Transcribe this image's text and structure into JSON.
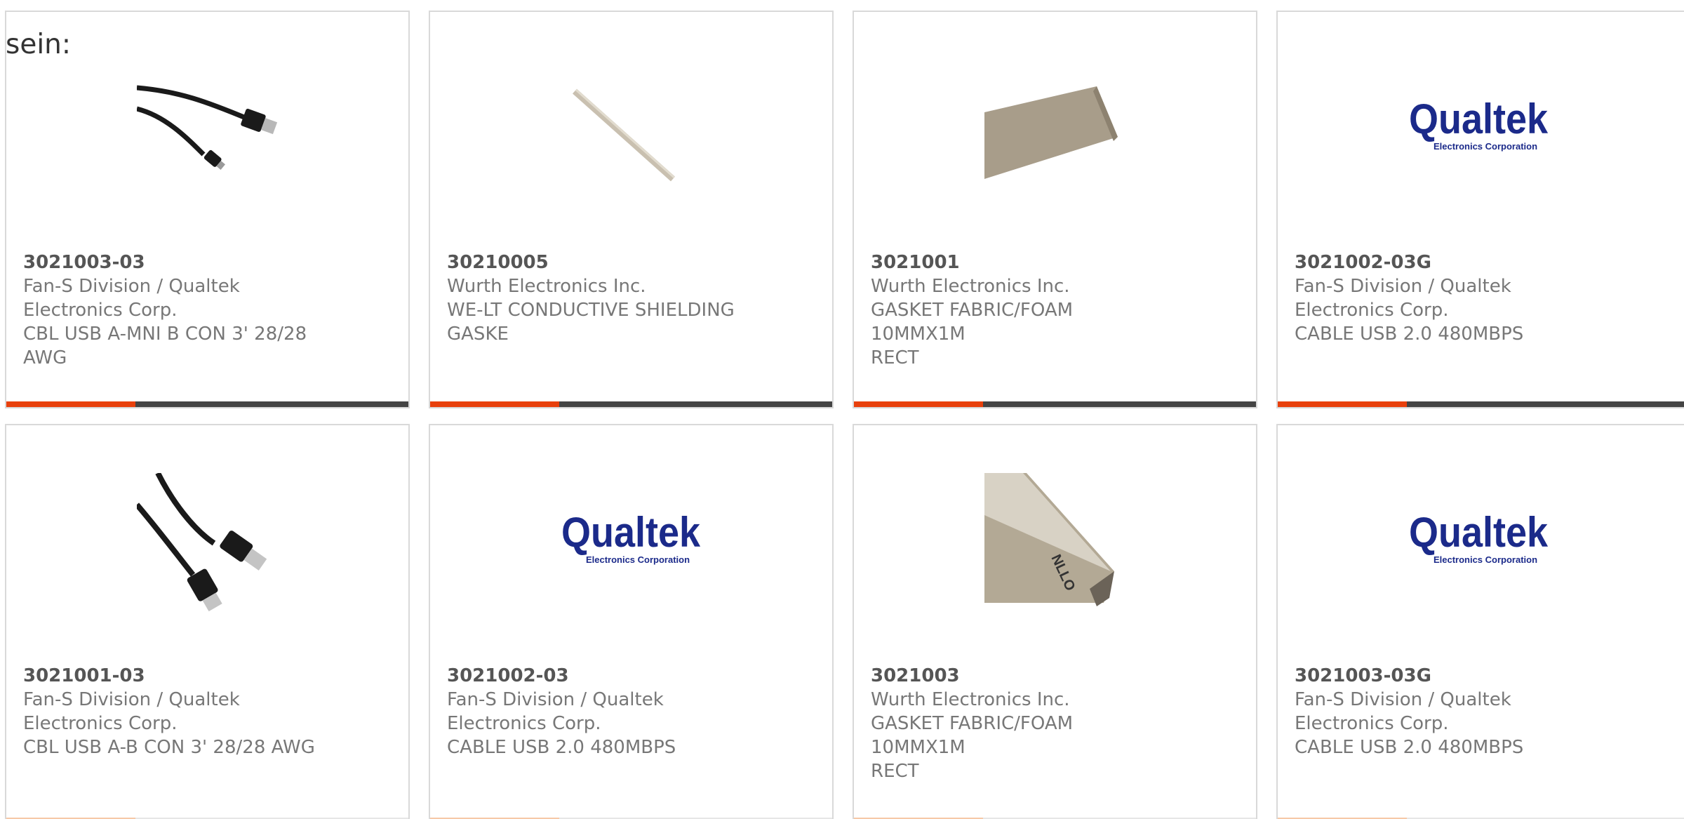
{
  "intro_text": "sein:",
  "products": [
    {
      "part_number": "3021003-03",
      "manufacturer_line1": "Fan-S Division / Qualtek",
      "manufacturer_line2": "Electronics Corp.",
      "description_line1": "CBL USB A-MNI B CON 3' 28/28",
      "description_line2": "AWG",
      "image": "usb-mini-cable-photo"
    },
    {
      "part_number": "30210005",
      "manufacturer_line1": "Wurth Electronics Inc.",
      "manufacturer_line2": "",
      "description_line1": "WE-LT CONDUCTIVE SHIELDING",
      "description_line2": "GASKE",
      "image": "shielding-strip-photo"
    },
    {
      "part_number": "3021001",
      "manufacturer_line1": "Wurth Electronics Inc.",
      "manufacturer_line2": "",
      "description_line1": "GASKET FABRIC/FOAM 10MMX1M",
      "description_line2": "RECT",
      "image": "fabric-gasket-photo"
    },
    {
      "part_number": "3021002-03G",
      "manufacturer_line1": "Fan-S Division / Qualtek",
      "manufacturer_line2": "Electronics Corp.",
      "description_line1": "CABLE USB 2.0 480MBPS",
      "description_line2": "",
      "image": "qualtek-logo"
    },
    {
      "part_number": "3021001-03",
      "manufacturer_line1": "Fan-S Division / Qualtek",
      "manufacturer_line2": "Electronics Corp.",
      "description_line1": "CBL USB A-B CON 3' 28/28 AWG",
      "description_line2": "",
      "image": "usb-ab-cable-photo"
    },
    {
      "part_number": "3021002-03",
      "manufacturer_line1": "Fan-S Division / Qualtek",
      "manufacturer_line2": "Electronics Corp.",
      "description_line1": "CABLE USB 2.0 480MBPS",
      "description_line2": "",
      "image": "qualtek-logo"
    },
    {
      "part_number": "3021003",
      "manufacturer_line1": "Wurth Electronics Inc.",
      "manufacturer_line2": "",
      "description_line1": "GASKET FABRIC/FOAM 10MMX1M",
      "description_line2": "RECT",
      "image": "gasket-profile-photo"
    },
    {
      "part_number": "3021003-03G",
      "manufacturer_line1": "Fan-S Division / Qualtek",
      "manufacturer_line2": "Electronics Corp.",
      "description_line1": "CABLE USB 2.0 480MBPS",
      "description_line2": "",
      "image": "qualtek-logo"
    }
  ],
  "logo": {
    "brand": "Qualtek",
    "tagline": "Electronics Corporation"
  },
  "colors": {
    "accent": "#e8400c",
    "bar": "#444444",
    "border": "#d9d9d9",
    "logo": "#1b2a8a"
  }
}
